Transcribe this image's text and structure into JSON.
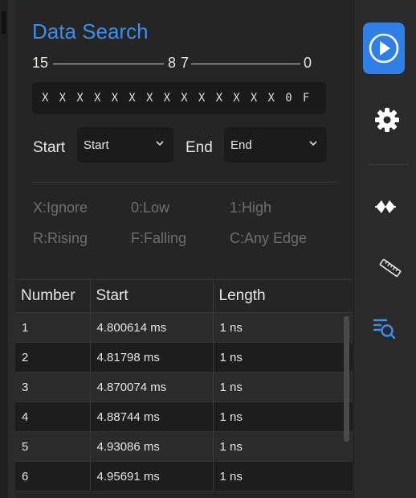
{
  "title": "Data Search",
  "bit_ruler": {
    "left": "15",
    "mid_high": "8",
    "mid_low": "7",
    "right": "0"
  },
  "pattern": "X X X X X X X X X X X X X X 0 F",
  "start": {
    "label": "Start",
    "value": "Start"
  },
  "end": {
    "label": "End",
    "value": "End"
  },
  "legend": [
    [
      "X:Ignore",
      "0:Low",
      "1:High"
    ],
    [
      "R:Rising",
      "F:Falling",
      "C:Any Edge"
    ]
  ],
  "table": {
    "headers": [
      "Number",
      "Start",
      "Length"
    ],
    "rows": [
      [
        "1",
        "4.800614 ms",
        "1 ns"
      ],
      [
        "2",
        "4.81798 ms",
        "1 ns"
      ],
      [
        "3",
        "4.870074 ms",
        "1 ns"
      ],
      [
        "4",
        "4.88744 ms",
        "1 ns"
      ],
      [
        "5",
        "4.93086 ms",
        "1 ns"
      ],
      [
        "6",
        "4.95691 ms",
        "1 ns"
      ]
    ]
  },
  "colors": {
    "accent": "#3b8ef0",
    "play_button": "#2f7fe6"
  },
  "sidebar_icons": [
    "play-icon",
    "gear-icon",
    "waveform-icon",
    "ruler-icon",
    "search-list-icon"
  ]
}
